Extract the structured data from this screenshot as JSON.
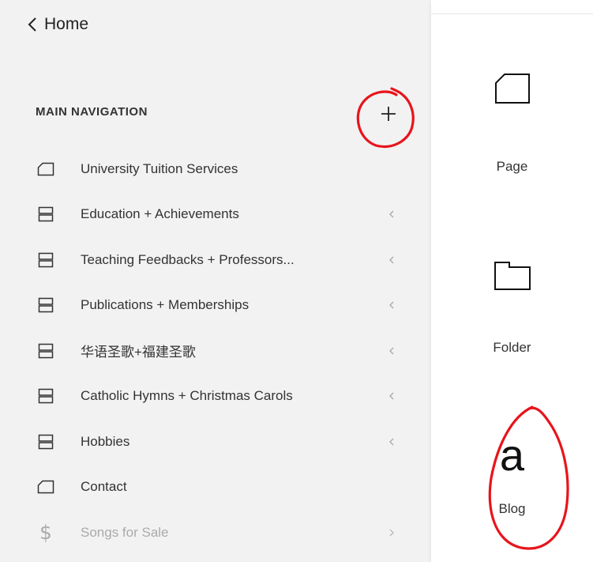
{
  "header": {
    "back_label": "Home"
  },
  "section": {
    "title": "MAIN NAVIGATION",
    "add_icon": "plus-icon"
  },
  "nav_items": [
    {
      "label": "University Tuition Services",
      "icon": "page-icon",
      "chevron": false,
      "disabled": false
    },
    {
      "label": "Education + Achievements",
      "icon": "index-icon",
      "chevron": true,
      "disabled": false
    },
    {
      "label": "Teaching Feedbacks + Professors...",
      "icon": "index-icon",
      "chevron": true,
      "disabled": false
    },
    {
      "label": "Publications + Memberships",
      "icon": "index-icon",
      "chevron": true,
      "disabled": false
    },
    {
      "label": "华语圣歌+福建圣歌",
      "icon": "index-icon",
      "chevron": true,
      "disabled": false
    },
    {
      "label": "Catholic Hymns + Christmas Carols",
      "icon": "index-icon",
      "chevron": true,
      "disabled": false
    },
    {
      "label": "Hobbies",
      "icon": "index-icon",
      "chevron": true,
      "disabled": false
    },
    {
      "label": "Contact",
      "icon": "page-icon",
      "chevron": false,
      "disabled": false
    },
    {
      "label": "Songs for Sale",
      "icon": "dollar-icon",
      "chevron": true,
      "disabled": true
    }
  ],
  "panel": {
    "tiles": [
      {
        "label": "Page",
        "icon": "page-icon"
      },
      {
        "label": "Folder",
        "icon": "folder-icon"
      },
      {
        "label": "Blog",
        "icon": "blog-icon",
        "glyph": "a"
      }
    ]
  },
  "colors": {
    "annotation": "#e8141c",
    "background": "#f2f2f2",
    "panel": "#ffffff"
  }
}
